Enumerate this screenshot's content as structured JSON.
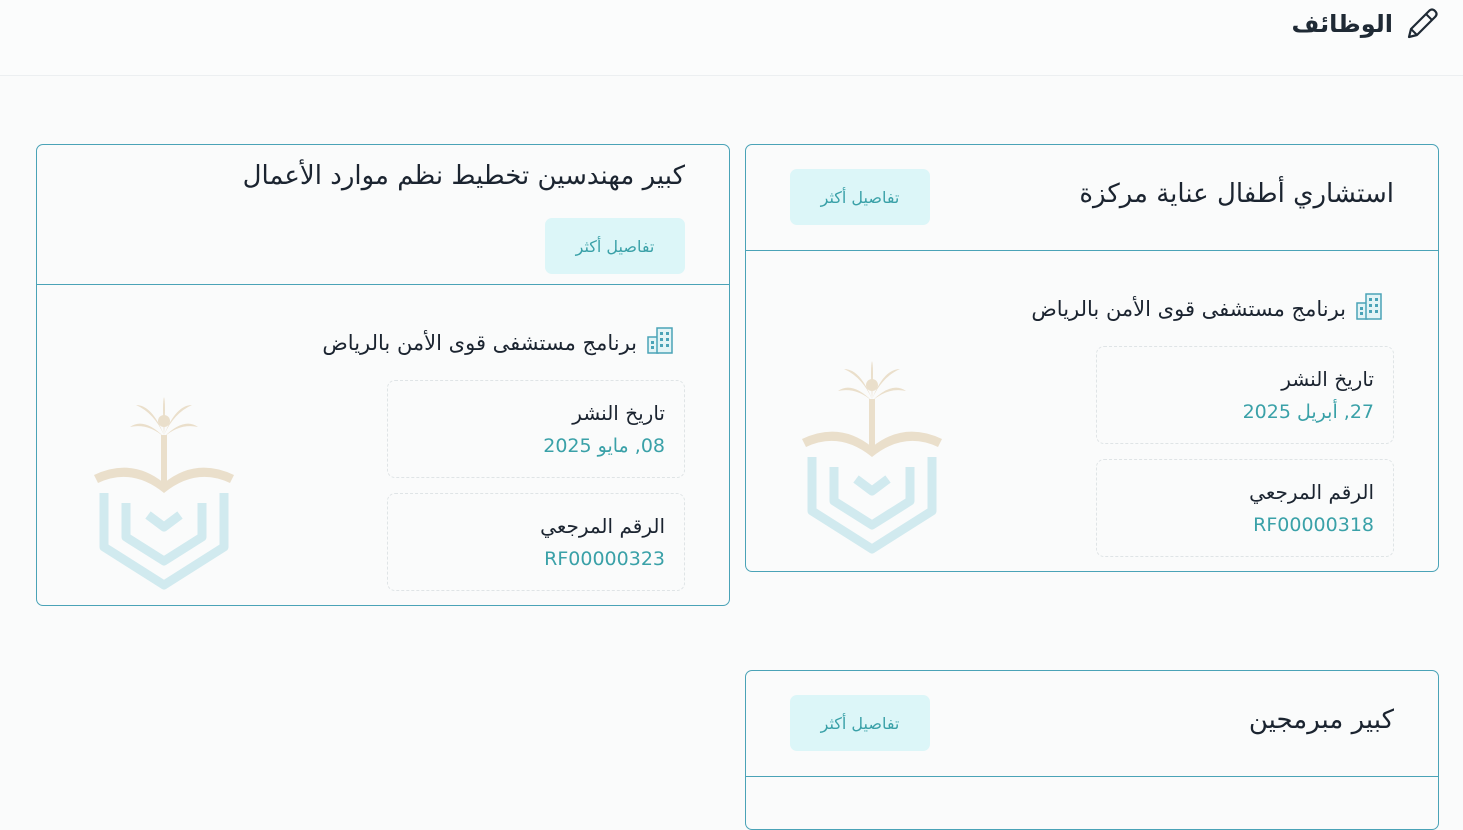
{
  "header": {
    "title": "الوظائف",
    "icon": "pencil-icon"
  },
  "colors": {
    "accent": "#3aa1a8",
    "card_border": "#4aa3b7",
    "button_bg": "#dcf6f8"
  },
  "jobs": [
    {
      "title": "استشاري أطفال عناية مركزة",
      "details_label": "تفاصيل أكثر",
      "employer": "برنامج مستشفى قوى الأمن بالرياض",
      "employer_icon": "building-icon",
      "date_label": "تاريخ النشر",
      "date_value": "27, أبريل 2025",
      "ref_label": "الرقم المرجعي",
      "ref_value": "RF00000318",
      "logo": "security-forces-hospital-logo"
    },
    {
      "title": "كبير مهندسين تخطيط نظم موارد الأعمال",
      "details_label": "تفاصيل أكثر",
      "employer": "برنامج مستشفى قوى الأمن بالرياض",
      "employer_icon": "building-icon",
      "date_label": "تاريخ النشر",
      "date_value": "08, مايو 2025",
      "ref_label": "الرقم المرجعي",
      "ref_value": "RF00000323",
      "logo": "security-forces-hospital-logo"
    },
    {
      "title": "كبير مبرمجين",
      "details_label": "تفاصيل أكثر"
    }
  ]
}
